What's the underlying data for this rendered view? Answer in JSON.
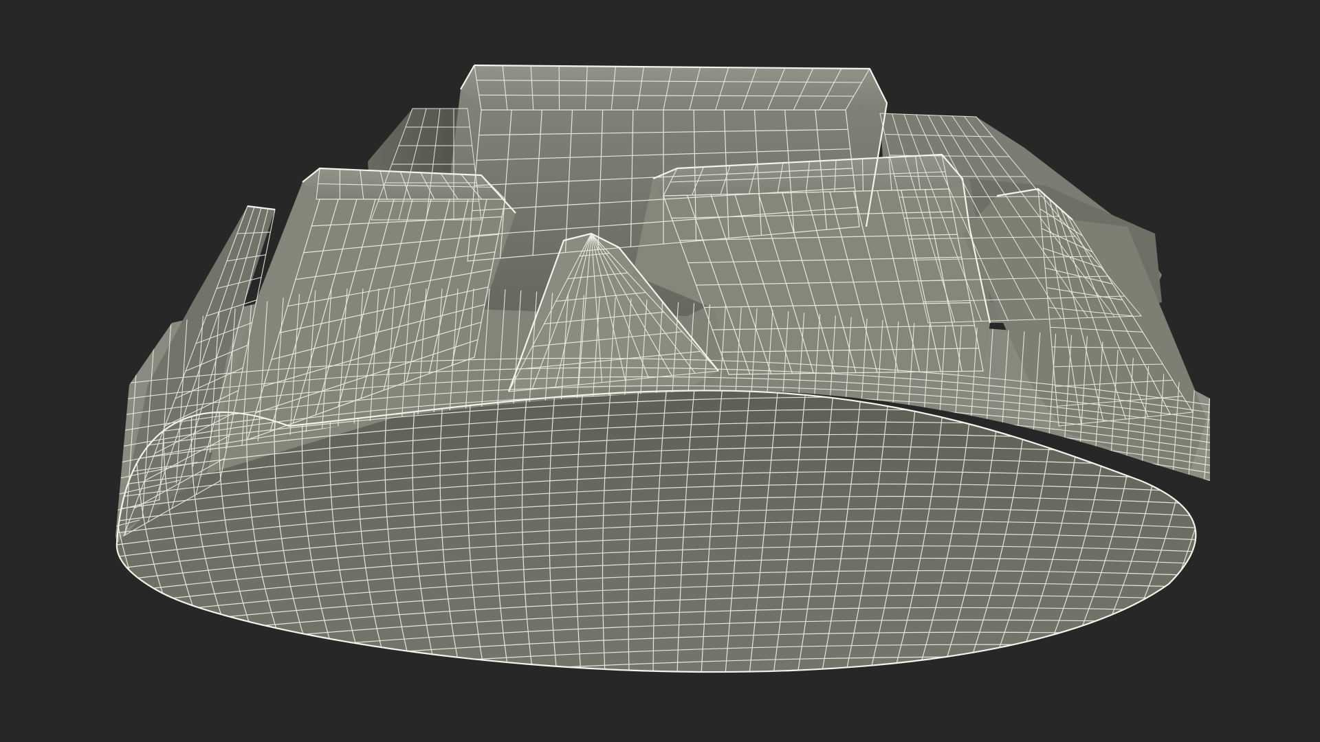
{
  "scene": {
    "background": "#272727",
    "model": {
      "kind": "wireframe-mesh",
      "surface_light": "#8a8a7e",
      "surface_mid": "#76766b",
      "surface_dark": "#55554c",
      "wire_color": "#f1f1e6",
      "lug_count": 6,
      "wedge_count": 1
    }
  }
}
